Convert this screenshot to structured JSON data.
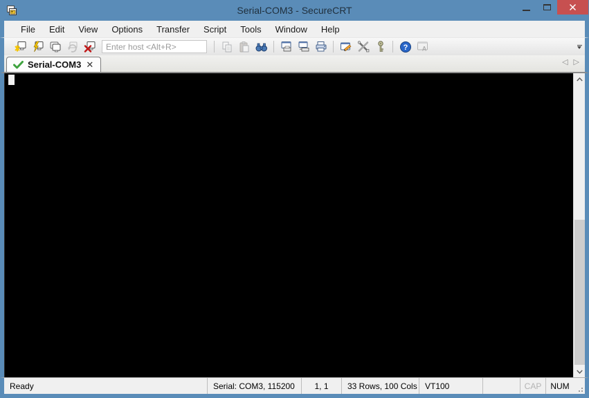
{
  "window": {
    "title": "Serial-COM3 - SecureCRT",
    "app_icon": "securecrt-cascade-windows",
    "controls": [
      "minimize",
      "maximize",
      "close"
    ]
  },
  "colors": {
    "titlebar_blue": "#5a8cb8",
    "close_red": "#c75050",
    "terminal_bg": "#000000",
    "cursor": "#f2f2f2",
    "check_green": "#3fa33f",
    "chrome_gray": "#f0f0f0"
  },
  "menubar": {
    "items": [
      "File",
      "Edit",
      "View",
      "Options",
      "Transfer",
      "Script",
      "Tools",
      "Window",
      "Help"
    ]
  },
  "toolbar": {
    "host_placeholder": "Enter host <Alt+R>",
    "icons": [
      "quick-connect",
      "connect",
      "connect-in-tab",
      "reconnect",
      "disconnect",
      "copy",
      "paste",
      "find",
      "print-screen",
      "auto-print",
      "print",
      "session-options",
      "global-options",
      "agent-key",
      "help",
      "appearance"
    ],
    "disabled_icons": [
      "reconnect",
      "copy",
      "paste",
      "appearance"
    ]
  },
  "tabbar": {
    "tabs": [
      {
        "label": "Serial-COM3",
        "status": "connected",
        "close_glyph": "✕"
      }
    ],
    "scroll_left_glyph": "◁",
    "scroll_right_glyph": "▷"
  },
  "terminal": {
    "content": "",
    "cursor_visible": true
  },
  "statusbar": {
    "ready": "Ready",
    "connection": "Serial: COM3, 115200",
    "cursor_position": "1,  1",
    "dimensions": "33 Rows, 100 Cols",
    "emulation": "VT100",
    "caps_lock": "CAP",
    "num_lock": "NUM"
  }
}
